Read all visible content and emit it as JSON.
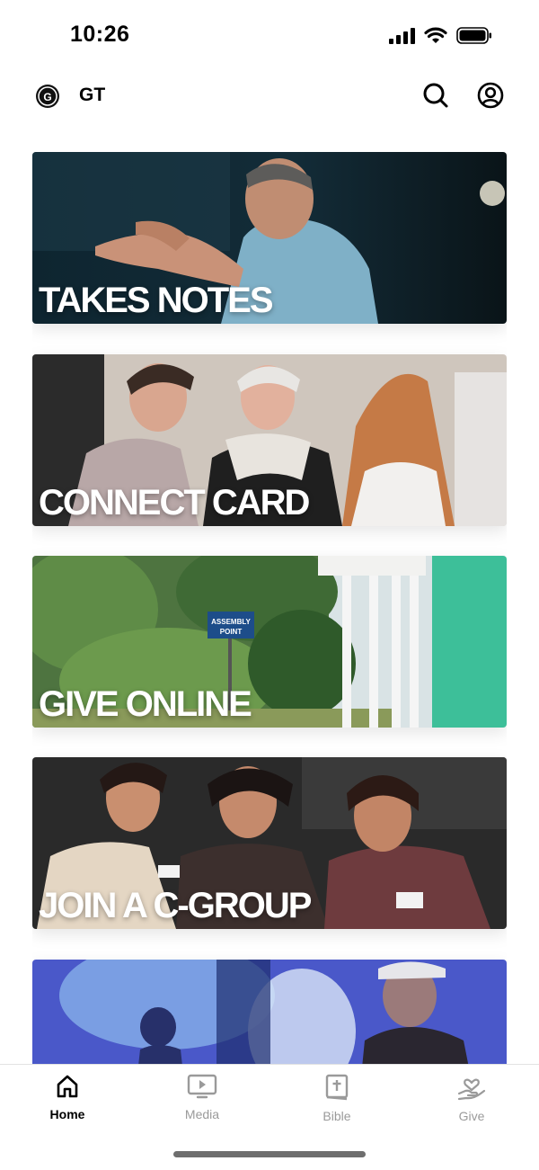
{
  "status_bar": {
    "time": "10:26"
  },
  "header": {
    "app_name": "GT"
  },
  "cards": [
    {
      "label": "TAKES NOTES"
    },
    {
      "label": "CONNECT CARD"
    },
    {
      "label": "GIVE ONLINE"
    },
    {
      "label": "JOIN A C-GROUP"
    },
    {
      "label": ""
    }
  ],
  "tab_bar": {
    "tabs": [
      {
        "label": "Home",
        "icon": "home-icon",
        "active": true
      },
      {
        "label": "Media",
        "icon": "media-icon",
        "active": false
      },
      {
        "label": "Bible",
        "icon": "bible-icon",
        "active": false
      },
      {
        "label": "Give",
        "icon": "give-icon",
        "active": false
      }
    ]
  },
  "colors": {
    "active": "#000000",
    "inactive": "#9a9a9a"
  }
}
